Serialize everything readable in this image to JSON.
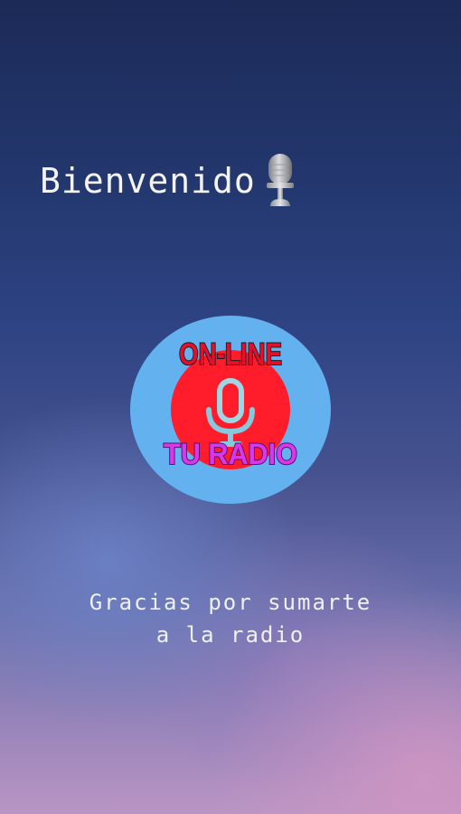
{
  "welcome": {
    "title": "Bienvenido",
    "icon": "microphone-icon"
  },
  "logo": {
    "top_text": "ON-LINE",
    "bottom_text": "TU RADIO",
    "icon": "microphone-icon",
    "colors": {
      "circle": "#63b2ef",
      "disc": "#ff1c2b",
      "top_text": "#e3102b",
      "bottom_text": "#d838ea"
    }
  },
  "message": {
    "line1": "Gracias por sumarte",
    "line2": "a la radio"
  }
}
